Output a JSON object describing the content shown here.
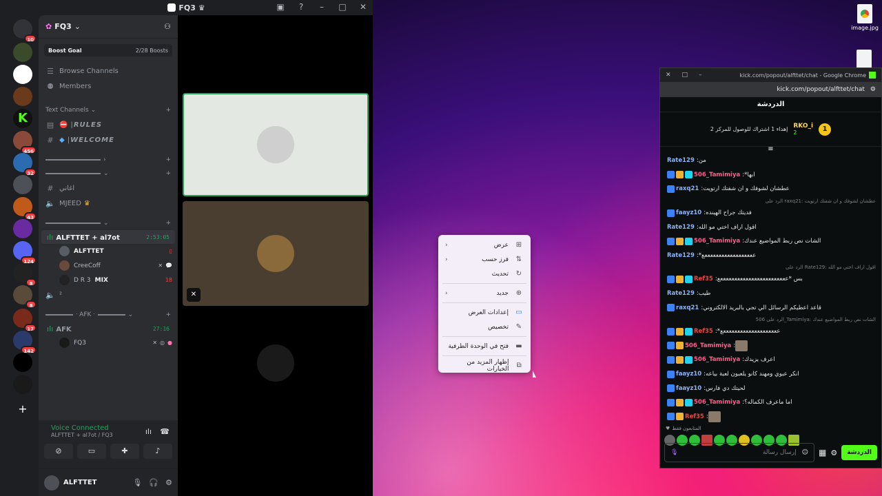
{
  "discord": {
    "title": "FQ3",
    "server_name": "FQ3",
    "boost_goal_label": "Boost Goal",
    "boost_count": "2/28 Boosts",
    "nav": [
      {
        "label": "Browse Channels"
      },
      {
        "label": "Members"
      }
    ],
    "text_channels_label": "Text Channels",
    "channels": [
      {
        "label": "RULES"
      },
      {
        "label": "WELCOME"
      }
    ],
    "plain_channels": [
      {
        "label": "اغاني"
      },
      {
        "label": "MJEED"
      }
    ],
    "guild_badges": [
      "10",
      "456",
      "32",
      "43",
      "124",
      "8",
      "8",
      "17",
      "142"
    ],
    "vc1": {
      "name": "ALFTTET + al7ot",
      "time": "2:53:05"
    },
    "vc1_users": [
      {
        "name": "ALFTTET"
      },
      {
        "name": "CreeCoff"
      },
      {
        "name": "D R 3",
        "tag": "MIX"
      }
    ],
    "afk_category": "AFK",
    "vc2": {
      "name": "AFK",
      "time": "27:16"
    },
    "vc2_users": [
      {
        "name": "FQ3"
      }
    ],
    "voice_status": "Voice Connected",
    "voice_sub": "ALFTTET + al7ot / FQ3",
    "username": "ALFTTET"
  },
  "context_menu": {
    "items": [
      {
        "label": "عرض",
        "icon": "grid-icon",
        "has_arrow": true
      },
      {
        "label": "فرز حسب",
        "icon": "sort-icon",
        "has_arrow": true
      },
      {
        "label": "تحديث",
        "icon": "refresh-icon",
        "has_arrow": false
      },
      {
        "label": "جديد",
        "icon": "plus-circle-icon",
        "has_arrow": true
      },
      {
        "label": "إعدادات العرض",
        "icon": "display-icon",
        "has_arrow": false
      },
      {
        "label": "تخصيص",
        "icon": "pen-icon",
        "has_arrow": false
      },
      {
        "label": "فتح في الوحدة الطرفية",
        "icon": "terminal-icon",
        "has_arrow": false
      },
      {
        "label": "إظهار المزيد من الخيارات",
        "icon": "more-icon",
        "has_arrow": false
      }
    ]
  },
  "chrome": {
    "tab_title": "kick.com/popout/alfttet/chat - Google Chrome",
    "url": "kick.com/popout/alfttet/chat",
    "chat_header": "الدردشة",
    "pinned_user": "RKO_i",
    "pinned_count": "2",
    "pinned_text": "إهداء 1 اشتراك للوصول للمركز 2",
    "messages": [
      {
        "user": "Rate129",
        "color": "#8ab4f8",
        "text": "من",
        "badges": 0
      },
      {
        "user": "506_Tamimiya",
        "color": "#ff5c8a",
        "text": "*ابها",
        "badges": 3
      },
      {
        "user": "raxq21",
        "color": "#8ab4f8",
        "text": "عطشان لشوفك و ان شفتك ارتويت",
        "badges": 1
      },
      {
        "reply": "الرد على raxq21: عطشان لشوفك و ان شفتك ارتويت"
      },
      {
        "user": "faayz10",
        "color": "#8ab4f8",
        "text": "فديتك جراح الهينده",
        "badges": 1
      },
      {
        "user": "Rate129",
        "color": "#8ab4f8",
        "text": "اقول اراف اختي مو الله",
        "badges": 0
      },
      {
        "user": "506_Tamimiya",
        "color": "#ff5c8a",
        "text": "الشات نص ربط المواضيع عندك",
        "badges": 3
      },
      {
        "user": "Rate129",
        "color": "#8ab4f8",
        "text": "*ععععععععععععععععععع",
        "badges": 0
      },
      {
        "reply": "الرد على Rate129: اقول اراف اختي مو الله"
      },
      {
        "user": "Ref35",
        "color": "#e8463f",
        "text": "بس *ععععععععععععععععععععععععع",
        "badges": 3
      },
      {
        "user": "Rate129",
        "color": "#8ab4f8",
        "text": "طيب",
        "badges": 0
      },
      {
        "user": "raxq21",
        "color": "#8ab4f8",
        "text": "قاعد اعطيكم الرسائل الي تجي بالبريد الالكتروني",
        "badges": 1
      },
      {
        "reply": "الرد على 506_Tamimiya: الشات نص ربط المواضيع عندك"
      },
      {
        "user": "Ref35",
        "color": "#e8463f",
        "text": "*ععععععععععععععععععععع",
        "badges": 3
      },
      {
        "user": "506_Tamimiya",
        "color": "#ff5c8a",
        "text": "",
        "badges": 2,
        "image": true
      },
      {
        "user": "506_Tamimiya",
        "color": "#ff5c8a",
        "text": "اعرف يزيدك",
        "badges": 3
      },
      {
        "user": "faayz10",
        "color": "#8ab4f8",
        "text": "انكر عبوي ومهند كانو يلعبون لعبة بياعه",
        "badges": 1
      },
      {
        "user": "faayz10",
        "color": "#8ab4f8",
        "text": "لحيتك دي فارس",
        "badges": 1
      },
      {
        "user": "506_Tamimiya",
        "color": "#ff5c8a",
        "text": "اما ماعرف الكماله؟",
        "badges": 3
      },
      {
        "user": "Ref35",
        "color": "#e8463f",
        "text": "",
        "badges": 2,
        "image": true
      }
    ],
    "followers_only": "المتابعون فقط",
    "input_placeholder": "إرسال رسالة",
    "send_label": "الدردشة"
  },
  "desktop": {
    "icon1": "image.jpg"
  },
  "colors": {
    "discord_bg": "#1e1f22",
    "sidebar_bg": "#2b2d31",
    "voice_green": "#23a55a",
    "kick_green": "#53fc18"
  }
}
